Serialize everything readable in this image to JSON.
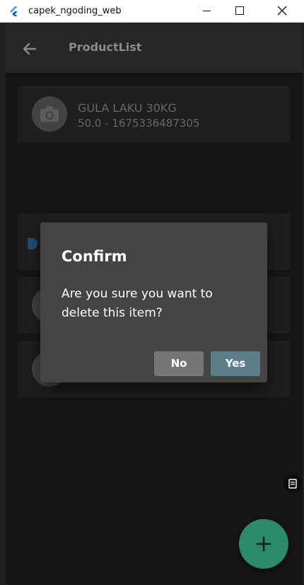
{
  "window": {
    "title": "capek_ngoding_web",
    "app_icon": "flutter-icon",
    "controls": [
      "minimize-icon",
      "maximize-icon",
      "close-icon"
    ]
  },
  "appbar": {
    "title": "ProductList",
    "back_icon": "arrow-left-icon"
  },
  "products": [
    {
      "name": "GULA LAKU 30KG",
      "subtitle": "50.0 - 1675336487305",
      "icon": "camera-icon"
    }
  ],
  "dialog": {
    "title": "Confirm",
    "message": "Are you sure you want to delete this item?",
    "no_label": "No",
    "yes_label": "Yes"
  },
  "fab": {
    "icon": "plus-icon"
  },
  "colors": {
    "dialog_bg": "#444444",
    "no_button": "#767676",
    "yes_button": "#5e7d8a",
    "fab": "#2a8a6a",
    "card_bg": "#2a2a2a"
  }
}
